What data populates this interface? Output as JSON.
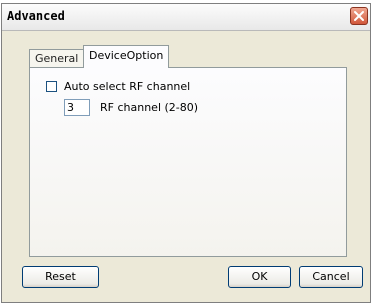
{
  "window": {
    "title": "Advanced"
  },
  "tabs": [
    {
      "label": "General",
      "selected": false
    },
    {
      "label": "DeviceOption",
      "selected": true
    }
  ],
  "device_option": {
    "auto_select_rf": {
      "label": "Auto select RF channel",
      "checked": false
    },
    "rf_channel": {
      "value": "3",
      "label": "RF channel (2-80)"
    }
  },
  "buttons": {
    "reset": "Reset",
    "ok": "OK",
    "cancel": "Cancel"
  },
  "icons": {
    "close": "close-icon"
  },
  "colors": {
    "close_button": "#d1573a",
    "window_face": "#ece9d8"
  }
}
